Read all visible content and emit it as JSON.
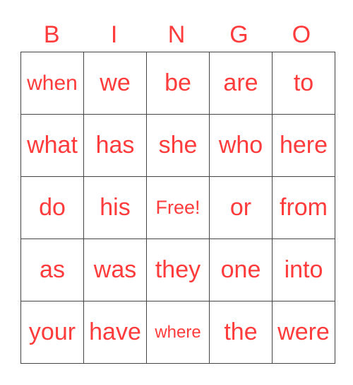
{
  "colors": {
    "text": "#ff3b3b",
    "grid": "#444444"
  },
  "header": [
    "B",
    "I",
    "N",
    "G",
    "O"
  ],
  "rows": [
    [
      "when",
      "we",
      "be",
      "are",
      "to"
    ],
    [
      "what",
      "has",
      "she",
      "who",
      "here"
    ],
    [
      "do",
      "his",
      "Free!",
      "or",
      "from"
    ],
    [
      "as",
      "was",
      "they",
      "one",
      "into"
    ],
    [
      "your",
      "have",
      "where",
      "the",
      "were"
    ]
  ]
}
